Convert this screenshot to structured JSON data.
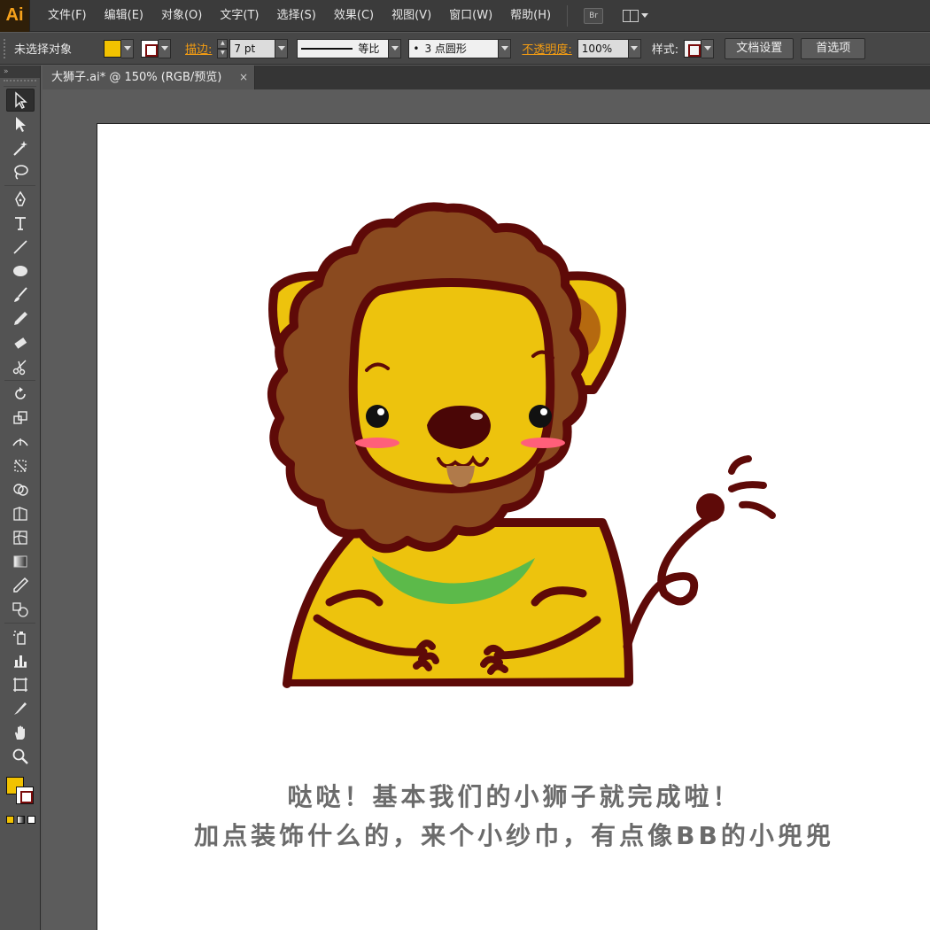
{
  "app": {
    "logo": "Ai",
    "menus": [
      "文件(F)",
      "编辑(E)",
      "对象(O)",
      "文字(T)",
      "选择(S)",
      "效果(C)",
      "视图(V)",
      "窗口(W)",
      "帮助(H)"
    ],
    "bridge_label": "Br"
  },
  "control": {
    "selection_status": "未选择对象",
    "stroke_label": "描边:",
    "stroke_weight": "7 pt",
    "profile_label": "等比",
    "brush_label": "3 点圆形",
    "brush_bullet": "•",
    "opacity_label": "不透明度:",
    "opacity_value": "100%",
    "style_label": "样式:",
    "doc_setup_button": "文档设置",
    "prefs_button": "首选项",
    "fill_color": "#f2c200",
    "stroke_color": "#7a0b0b"
  },
  "tab": {
    "title": "大狮子.ai* @ 150% (RGB/预览)",
    "close": "×"
  },
  "tools": {
    "panel_collapse": "»"
  },
  "artwork": {
    "caption_line1": "哒哒！基本我们的小狮子就完成啦！",
    "caption_line2": "加点装饰什么的，来个小纱巾，有点像BB的小兜兜",
    "colors": {
      "outline": "#5e0a08",
      "mane": "#8a4a1f",
      "face": "#edc30d",
      "ear_inner": "#b5690f",
      "scarf": "#5cba4a",
      "blush": "#ff5f7a",
      "tongue": "#b07a4a"
    }
  }
}
